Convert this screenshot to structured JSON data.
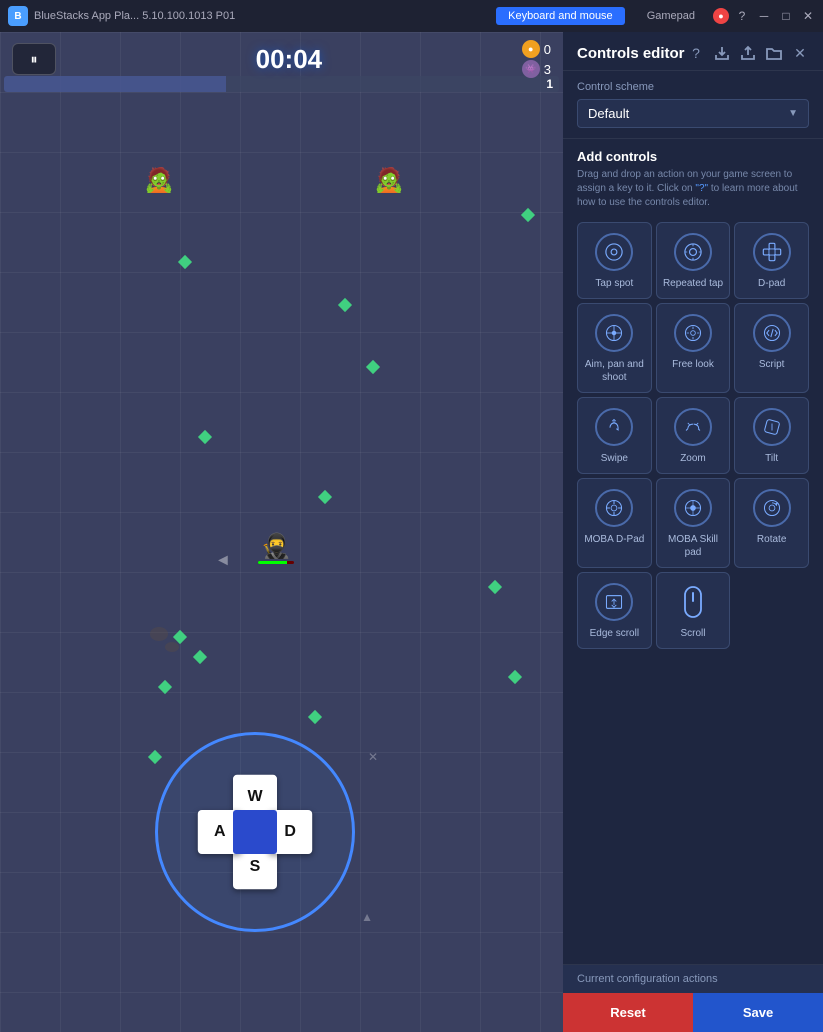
{
  "titlebar": {
    "appname": "BlueStacks App Pla...  5.10.100.1013 P01",
    "tab_keyboard": "Keyboard and mouse",
    "tab_gamepad": "Gamepad",
    "gamepad_indicator": "●"
  },
  "game": {
    "timer": "00:04",
    "score_gold": "0",
    "score_brain": "3",
    "level": "1",
    "pause_label": "⏸"
  },
  "panel": {
    "title": "Controls editor",
    "scheme_label": "Control scheme",
    "scheme_value": "Default",
    "add_controls_title": "Add controls",
    "add_controls_desc": "Drag and drop an action on your game screen to assign a key to it. Click on \"?\" to learn more about how to use the controls editor.",
    "controls": [
      {
        "id": "tap_spot",
        "label": "Tap spot"
      },
      {
        "id": "repeated_tap",
        "label": "Repeated tap"
      },
      {
        "id": "d_pad",
        "label": "D-pad"
      },
      {
        "id": "aim_pan_shoot",
        "label": "Aim, pan and shoot"
      },
      {
        "id": "free_look",
        "label": "Free look"
      },
      {
        "id": "script",
        "label": "Script"
      },
      {
        "id": "swipe",
        "label": "Swipe"
      },
      {
        "id": "zoom",
        "label": "Zoom"
      },
      {
        "id": "tilt",
        "label": "Tilt"
      },
      {
        "id": "moba_dpad",
        "label": "MOBA D-Pad"
      },
      {
        "id": "moba_skill_pad",
        "label": "MOBA Skill pad"
      },
      {
        "id": "rotate",
        "label": "Rotate"
      },
      {
        "id": "edge_scroll",
        "label": "Edge scroll"
      },
      {
        "id": "scroll",
        "label": "Scroll"
      }
    ],
    "current_config_label": "Current configuration actions",
    "reset_label": "Reset",
    "save_label": "Save"
  },
  "dpad": {
    "up": "W",
    "down": "S",
    "left": "A",
    "right": "D"
  }
}
